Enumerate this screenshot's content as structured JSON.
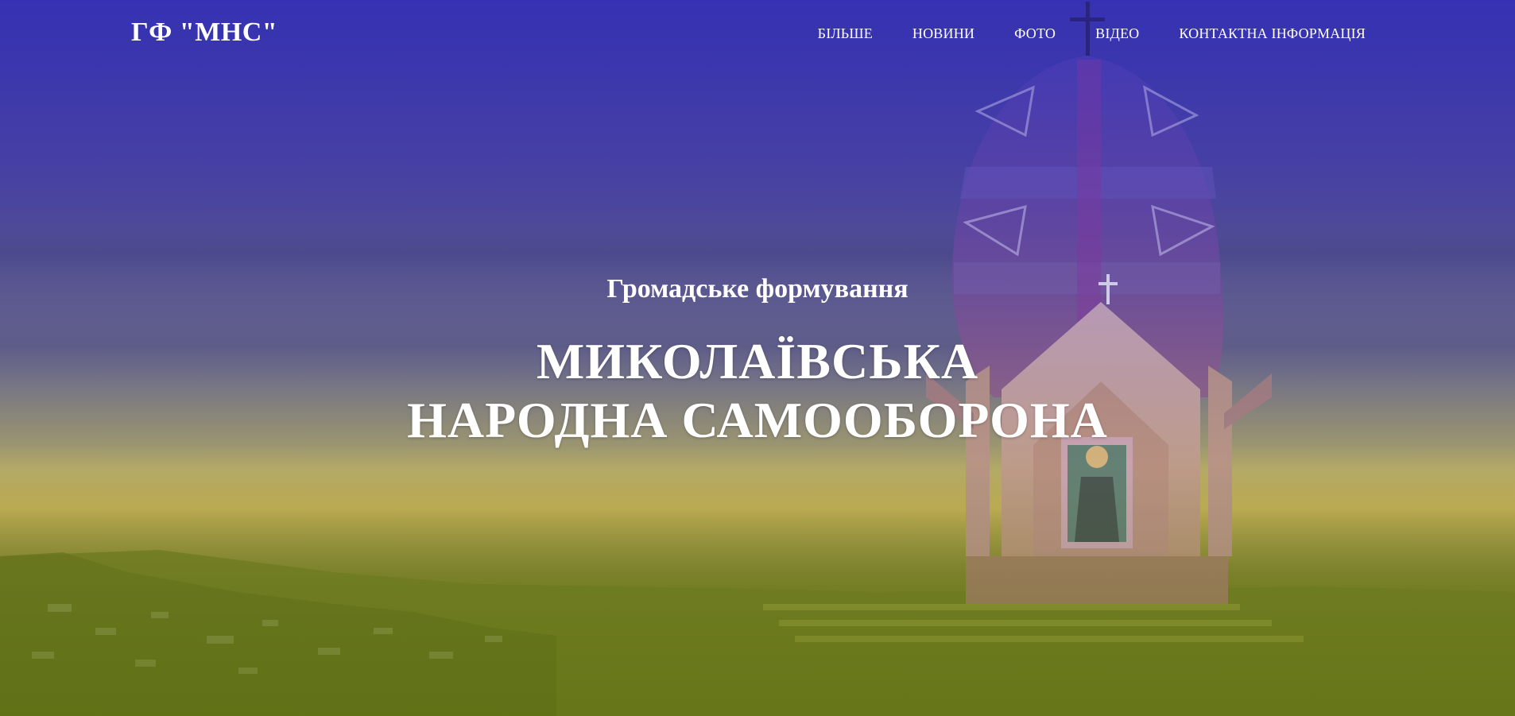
{
  "navbar": {
    "brand": "ГФ \"МНС\"",
    "items": [
      {
        "label": "БІЛЬШЕ"
      },
      {
        "label": "НОВИНИ"
      },
      {
        "label": "ФОТО"
      },
      {
        "label": "ВІДЕО"
      },
      {
        "label": "КОНТАКТНА ІНФОРМАЦІЯ"
      }
    ]
  },
  "hero": {
    "subtitle": "Громадське формування",
    "title": "МИКОЛАЇВСЬКА НАРОДНА САМООБОРОНА"
  },
  "colors": {
    "sky_top": "#3a34ad",
    "horizon": "#a7a06a",
    "ground": "#6b7b10",
    "text": "#ffffff"
  }
}
